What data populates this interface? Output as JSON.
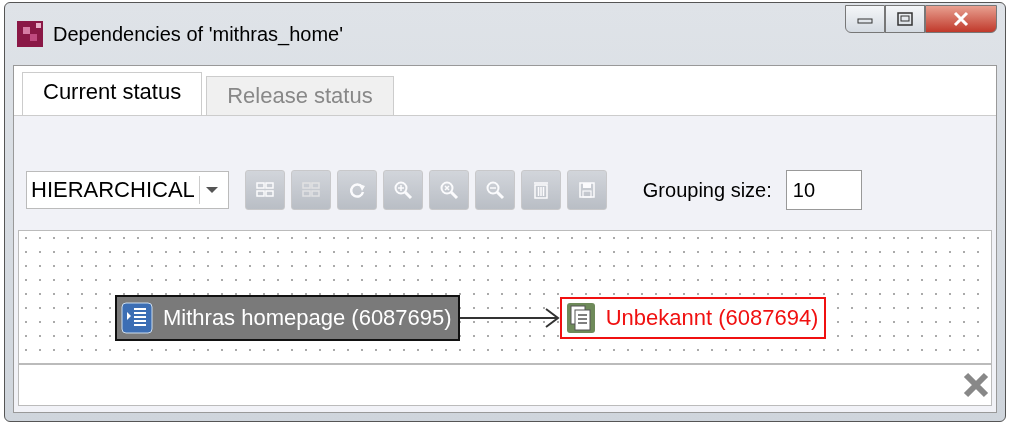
{
  "window": {
    "title": "Dependencies of 'mithras_home'"
  },
  "tabs": [
    {
      "label": "Current status",
      "selected": true
    },
    {
      "label": "Release status",
      "selected": false
    }
  ],
  "toolbar": {
    "layout": "HIERARCHICAL",
    "buttons": [
      {
        "kind": "expand",
        "disabled": true
      },
      {
        "kind": "collapse",
        "disabled": true
      },
      {
        "kind": "refresh",
        "disabled": true
      },
      {
        "kind": "zoom-in",
        "disabled": true
      },
      {
        "kind": "zoom-reset",
        "disabled": true
      },
      {
        "kind": "zoom-out",
        "disabled": true
      },
      {
        "kind": "delete",
        "disabled": true
      },
      {
        "kind": "save",
        "disabled": true
      }
    ],
    "grouping_label": "Grouping size:",
    "grouping_value": "10"
  },
  "graph": {
    "nodes": [
      {
        "label": "Mithras homepage (6087695)",
        "kind": "page",
        "selected": true,
        "missing": false
      },
      {
        "label": "Unbekannt (6087694)",
        "kind": "document",
        "selected": false,
        "missing": true
      }
    ]
  }
}
